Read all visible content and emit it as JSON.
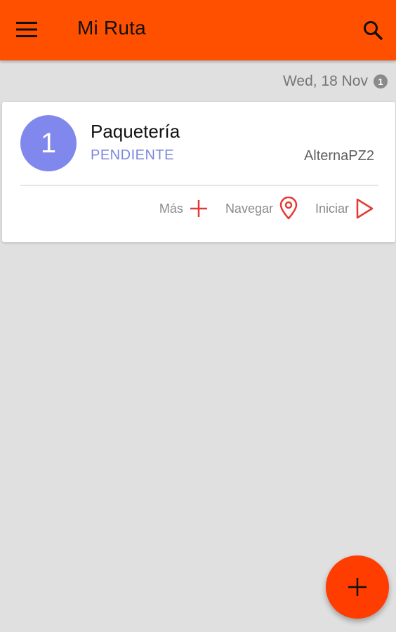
{
  "colors": {
    "appbar": "#ff5000",
    "background": "#e0e0e0",
    "accent_red": "#e53935",
    "avatar": "#8088ee",
    "status": "#7b86e0",
    "fab": "#ff3d00"
  },
  "appbar": {
    "title": "Mi Ruta",
    "menu_icon": "menu-icon",
    "search_icon": "search-icon"
  },
  "date_header": {
    "date": "Wed, 18 Nov",
    "count": "1"
  },
  "route_card": {
    "number": "1",
    "title": "Paquetería",
    "status": "PENDIENTE",
    "route_name": "AlternaPZ2",
    "actions": [
      {
        "label": "Más",
        "icon": "plus-icon"
      },
      {
        "label": "Navegar",
        "icon": "location-pin-icon"
      },
      {
        "label": "Iniciar",
        "icon": "play-icon"
      }
    ]
  },
  "fab": {
    "icon": "plus-icon"
  }
}
